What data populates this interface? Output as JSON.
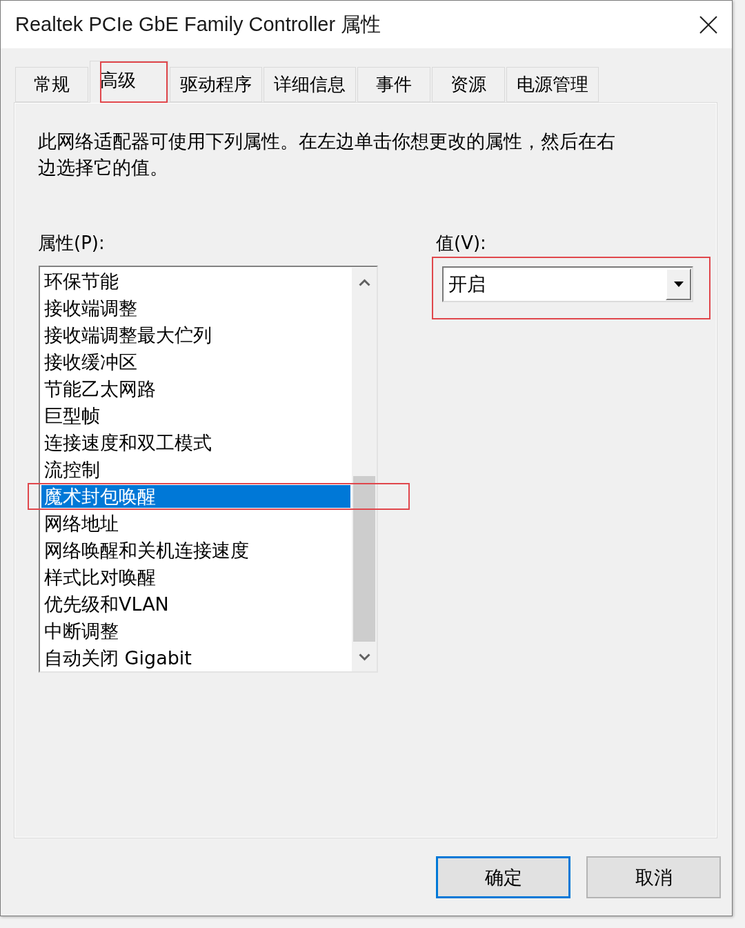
{
  "window": {
    "title": "Realtek PCIe GbE Family Controller 属性"
  },
  "tabs": [
    {
      "label": "常规",
      "selected": false,
      "highlighted": false
    },
    {
      "label": "高级",
      "selected": true,
      "highlighted": true
    },
    {
      "label": "驱动程序",
      "selected": false,
      "highlighted": false
    },
    {
      "label": "详细信息",
      "selected": false,
      "highlighted": false
    },
    {
      "label": "事件",
      "selected": false,
      "highlighted": false
    },
    {
      "label": "资源",
      "selected": false,
      "highlighted": false
    },
    {
      "label": "电源管理",
      "selected": false,
      "highlighted": false
    }
  ],
  "description": "此网络适配器可使用下列属性。在左边单击你想更改的属性，然后在右边选择它的值。",
  "properties": {
    "label": "属性(P):",
    "items": [
      {
        "label": "环保节能",
        "selected": false,
        "highlighted": false
      },
      {
        "label": "接收端调整",
        "selected": false,
        "highlighted": false
      },
      {
        "label": "接收端调整最大伫列",
        "selected": false,
        "highlighted": false
      },
      {
        "label": "接收缓冲区",
        "selected": false,
        "highlighted": false
      },
      {
        "label": "节能乙太网路",
        "selected": false,
        "highlighted": false
      },
      {
        "label": "巨型帧",
        "selected": false,
        "highlighted": false
      },
      {
        "label": "连接速度和双工模式",
        "selected": false,
        "highlighted": false
      },
      {
        "label": "流控制",
        "selected": false,
        "highlighted": false
      },
      {
        "label": "魔术封包唤醒",
        "selected": true,
        "highlighted": true
      },
      {
        "label": "网络地址",
        "selected": false,
        "highlighted": false
      },
      {
        "label": "网络唤醒和关机连接速度",
        "selected": false,
        "highlighted": false
      },
      {
        "label": "样式比对唤醒",
        "selected": false,
        "highlighted": false
      },
      {
        "label": "优先级和VLAN",
        "selected": false,
        "highlighted": false
      },
      {
        "label": "中断调整",
        "selected": false,
        "highlighted": false
      },
      {
        "label": "自动关闭 Gigabit",
        "selected": false,
        "highlighted": false
      }
    ]
  },
  "value": {
    "label": "值(V):",
    "value": "开启",
    "highlighted": true
  },
  "buttons": [
    {
      "label": "确定",
      "default": true
    },
    {
      "label": "取消",
      "default": false
    }
  ]
}
